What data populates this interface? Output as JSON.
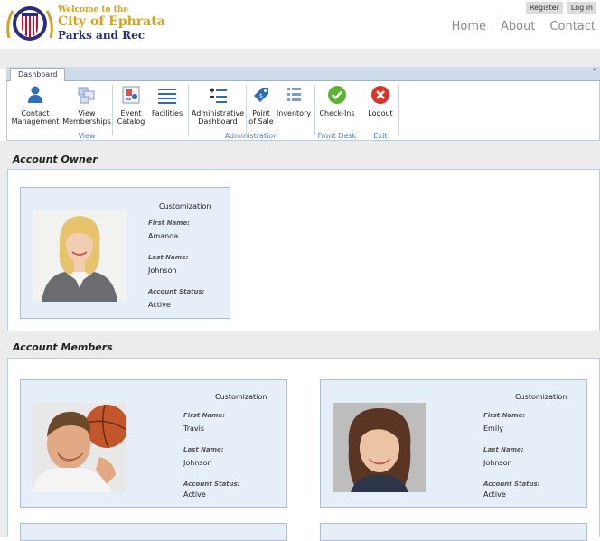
{
  "header": {
    "welcome": "Welcome to the",
    "city": "City of Ephrata",
    "parks": "Parks and Rec",
    "register": "Register",
    "login": "Log in",
    "nav": [
      "Home",
      "About",
      "Contact"
    ]
  },
  "ribbon": {
    "tab": "Dashboard",
    "buttons": [
      {
        "label1": "Contact",
        "label2": "Management",
        "icon": "person-icon"
      },
      {
        "label1": "View",
        "label2": "Memberships",
        "icon": "cards-icon"
      },
      {
        "label1": "Event",
        "label2": "Catalog",
        "icon": "catalog-icon"
      },
      {
        "label1": "Facilities",
        "label2": "",
        "icon": "list-icon"
      },
      {
        "label1": "Administrative",
        "label2": "Dashboard",
        "icon": "admin-list-icon"
      },
      {
        "label1": "Point",
        "label2": "of Sale",
        "icon": "tag-icon"
      },
      {
        "label1": "Inventory",
        "label2": "",
        "icon": "inventory-icon"
      },
      {
        "label1": "Check-Ins",
        "label2": "",
        "icon": "checkmark-icon"
      },
      {
        "label1": "Logout",
        "label2": "",
        "icon": "logout-icon"
      }
    ],
    "groups": [
      "View",
      "Administration",
      "Front Desk",
      "Exit"
    ]
  },
  "sections": {
    "owner_title": "Account Owner",
    "members_title": "Account Members"
  },
  "labels": {
    "customization": "Customization",
    "first_name": "First Name:",
    "last_name": "Last Name:",
    "status": "Account Status:"
  },
  "owner": {
    "first": "Amanda",
    "last": "Johnson",
    "status": "Active"
  },
  "members": [
    {
      "first": "Travis",
      "last": "Johnson",
      "status": "Active"
    },
    {
      "first": "Emily",
      "last": "Johnson",
      "status": "Active"
    }
  ],
  "colors": {
    "accent": "#4a7fbf",
    "gold": "#d9a21b",
    "navy": "#2b2f7a"
  }
}
